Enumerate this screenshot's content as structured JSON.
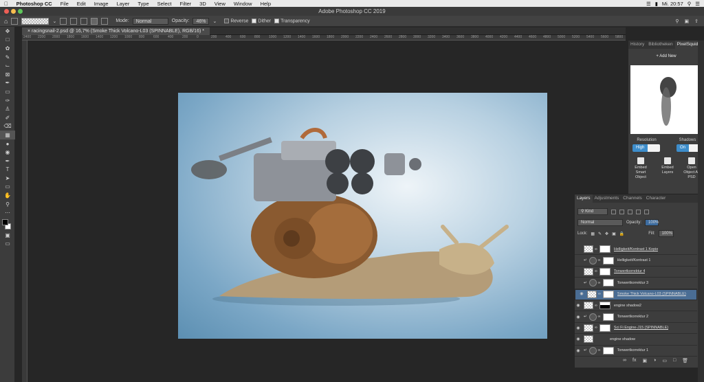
{
  "menubar": {
    "app": "Photoshop CC",
    "items": [
      "File",
      "Edit",
      "Image",
      "Layer",
      "Type",
      "Select",
      "Filter",
      "3D",
      "View",
      "Window",
      "Help"
    ],
    "clock": "Mi. 20:57"
  },
  "window": {
    "title": "Adobe Photoshop CC 2019"
  },
  "options": {
    "mode_label": "Mode:",
    "mode_value": "Normal",
    "opacity_label": "Opacity:",
    "opacity_value": "46%",
    "reverse": "Reverse",
    "dither": "Dither",
    "transparency": "Transparency"
  },
  "document": {
    "tab_title": "racingsnail-2.psd @ 16,7% (Smoke Thick Volcano-L03 (SPINNABLE), RGB/16) *"
  },
  "ruler": {
    "ticks": [
      "2400",
      "2200",
      "2000",
      "1800",
      "1600",
      "1400",
      "1200",
      "1000",
      "800",
      "600",
      "400",
      "200",
      "0",
      "200",
      "400",
      "600",
      "800",
      "1000",
      "1200",
      "1400",
      "1600",
      "1800",
      "2000",
      "2200",
      "2400",
      "2600",
      "2800",
      "3000",
      "3200",
      "3400",
      "3600",
      "3800",
      "4000",
      "4200",
      "4400",
      "4600",
      "4800",
      "5000",
      "5200",
      "5400",
      "5600",
      "5800"
    ]
  },
  "pixelsquid": {
    "tabs": [
      "History",
      "Bibliotheken",
      "PixelSquid"
    ],
    "add_new": "+ Add New",
    "resolution_label": "Resolution",
    "resolution_value": "High",
    "shadows_label": "Shadows",
    "shadows_value": "On",
    "actions": [
      "Embed Smart Object",
      "Embed Layers",
      "Open Object As PSD"
    ]
  },
  "layers_panel": {
    "tabs": [
      "Layers",
      "Adjustments",
      "Channels",
      "Character"
    ],
    "kind": "Kind",
    "blend_mode": "Normal",
    "opacity_label": "Opacity:",
    "opacity_value": "100%",
    "lock_label": "Lock:",
    "fill_label": "Fill:",
    "fill_value": "100%",
    "layers": [
      {
        "name": "Helligkeit/Kontrast 1 Kopie",
        "visible": false,
        "linked_name": true
      },
      {
        "name": "Helligkeit/Kontrast 1",
        "visible": false,
        "linked_name": false
      },
      {
        "name": "Tonwertkorrektur 4",
        "visible": false,
        "linked_name": true
      },
      {
        "name": "Tonwertkorrektur 3",
        "visible": false,
        "linked_name": false
      },
      {
        "name": "Smoke Thick Volcano-L03 (SPINNABLE)",
        "visible": true,
        "linked_name": true,
        "selected": true
      },
      {
        "name": "engine shadow2",
        "visible": true,
        "linked_name": false
      },
      {
        "name": "Tonwertkorrektur 2",
        "visible": true,
        "linked_name": false
      },
      {
        "name": "Sci Fi Engine-J15 (SPINNABLE)",
        "visible": true,
        "linked_name": true
      },
      {
        "name": "engine shadow",
        "visible": true,
        "linked_name": false
      },
      {
        "name": "Tonwertkorrektur 1",
        "visible": true,
        "linked_name": false
      }
    ]
  }
}
